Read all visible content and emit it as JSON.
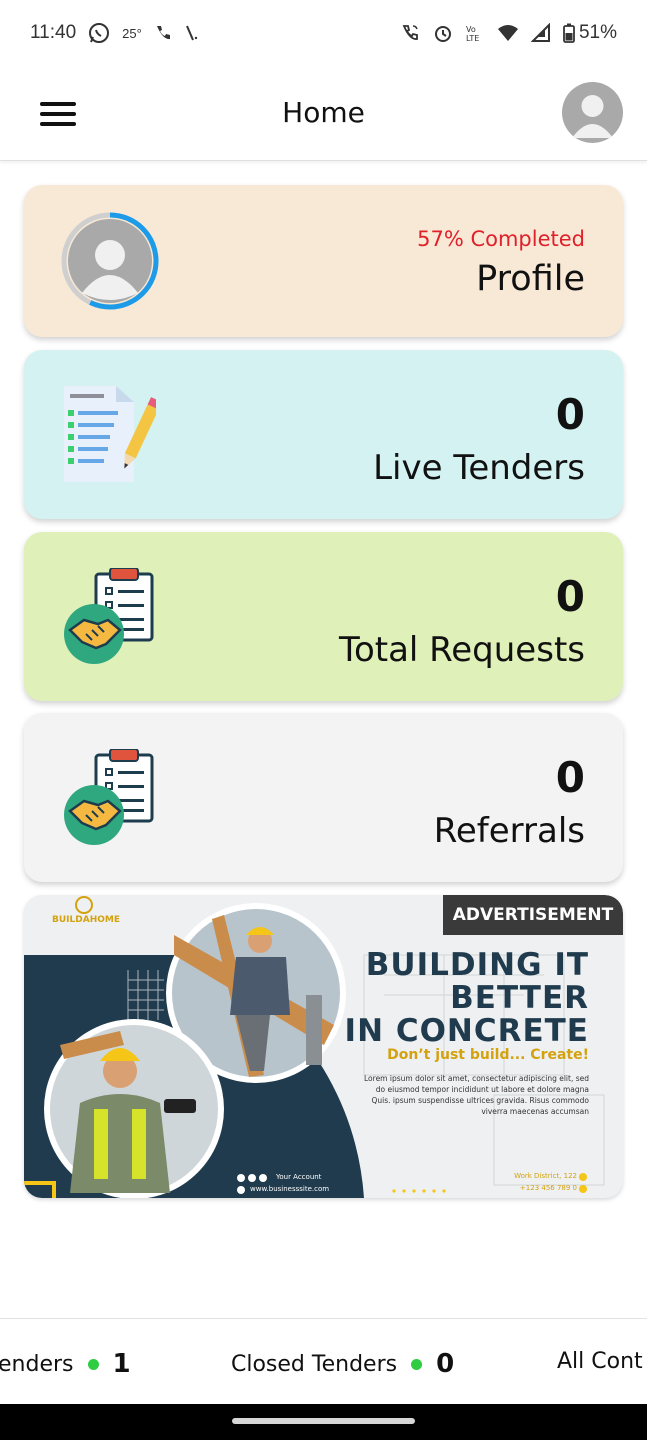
{
  "status_bar": {
    "time": "11:40",
    "temperature": "25°",
    "battery": "51%",
    "left_icons": [
      "whatsapp-icon",
      "phone-icon",
      "missed-signal-icon"
    ],
    "right_icons": [
      "wifi-call-icon",
      "alarm-icon",
      "volte-icon",
      "wifi-icon",
      "signal-icon",
      "battery-icon"
    ]
  },
  "app_bar": {
    "title": "Home"
  },
  "cards": {
    "profile": {
      "status": "57% Completed",
      "label": "Profile",
      "progress": 0.57,
      "status_color": "#e0202a",
      "ring_color": "#1e9be8"
    },
    "live_tenders": {
      "count": "0",
      "label": "Live Tenders"
    },
    "total_requests": {
      "count": "0",
      "label": "Total Requests"
    },
    "referrals": {
      "count": "0",
      "label": "Referrals"
    }
  },
  "ad": {
    "badge": "ADVERTISEMENT",
    "brand": "BUILDAHOME",
    "headline_1": "BUILDING IT",
    "headline_2": "BETTER",
    "headline_3": "IN CONCRETE",
    "tagline": "Don’t just build... Create!",
    "body": "Lorem ipsum dolor sit amet, consectetur adipiscing elit, sed do eiusmod tempor incididunt ut labore et dolore magna Quis. ipsum suspendisse ultrices gravida. Risus commodo viverra maecenas accumsan",
    "account": "Your Account",
    "website": "www.businesssite.com",
    "address": "Work District, 122",
    "phone": "+123 456 789 0"
  },
  "ticker": {
    "items": [
      {
        "label": "enders",
        "count": "1"
      },
      {
        "label": "Closed Tenders",
        "count": "0"
      },
      {
        "label": "All Cont",
        "count": ""
      }
    ],
    "dot_color": "#2ecc40"
  }
}
